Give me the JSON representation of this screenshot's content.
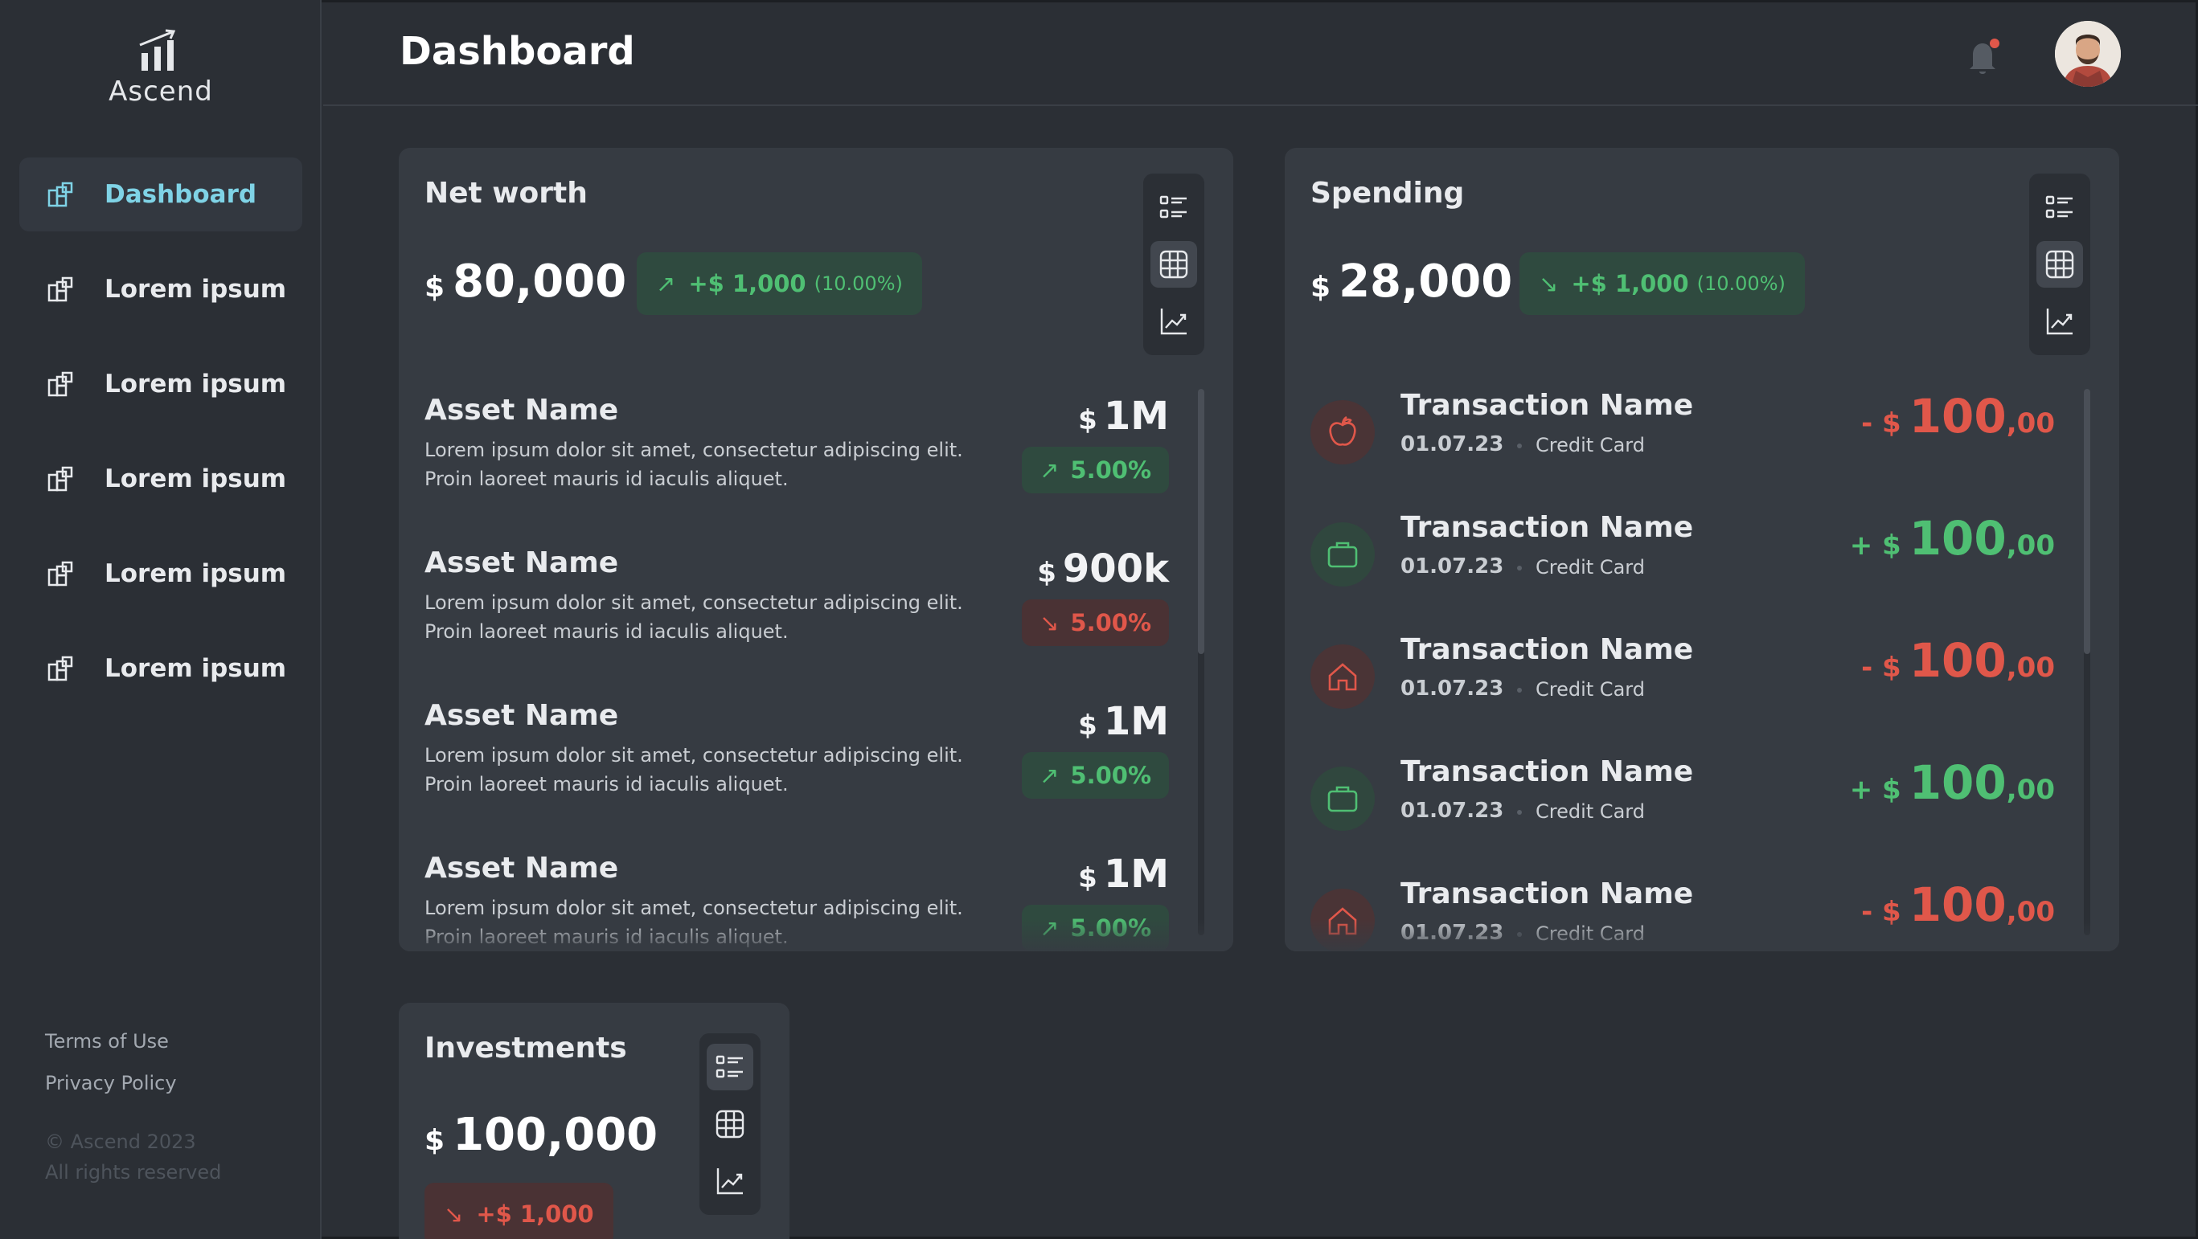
{
  "app": {
    "name": "Ascend"
  },
  "header": {
    "title": "Dashboard"
  },
  "sidebar": {
    "items": [
      {
        "label": "Dashboard",
        "active": true
      },
      {
        "label": "Lorem ipsum"
      },
      {
        "label": "Lorem ipsum"
      },
      {
        "label": "Lorem ipsum"
      },
      {
        "label": "Lorem ipsum"
      },
      {
        "label": "Lorem ipsum"
      }
    ],
    "footer": {
      "terms": "Terms of Use",
      "privacy": "Privacy Policy",
      "copyright": "© Ascend 2023",
      "rights": "All rights reserved"
    }
  },
  "net_worth": {
    "title": "Net worth",
    "currency": "$",
    "amount": "80,000",
    "change": "+$ 1,000",
    "change_pct": "(10.00%)",
    "assets": [
      {
        "name": "Asset Name",
        "desc": "Lorem ipsum dolor sit amet, consectetur adipiscing elit. Proin laoreet mauris id iaculis aliquet.",
        "currency": "$",
        "value": "1M",
        "change": "5.00%",
        "trend": "up"
      },
      {
        "name": "Asset Name",
        "desc": "Lorem ipsum dolor sit amet, consectetur adipiscing elit. Proin laoreet mauris id iaculis aliquet.",
        "currency": "$",
        "value": "900k",
        "change": "5.00%",
        "trend": "down"
      },
      {
        "name": "Asset Name",
        "desc": "Lorem ipsum dolor sit amet, consectetur adipiscing elit. Proin laoreet mauris id iaculis aliquet.",
        "currency": "$",
        "value": "1M",
        "change": "5.00%",
        "trend": "up"
      },
      {
        "name": "Asset Name",
        "desc": "Lorem ipsum dolor sit amet, consectetur adipiscing elit. Proin laoreet mauris id iaculis aliquet.",
        "currency": "$",
        "value": "1M",
        "change": "5.00%",
        "trend": "up"
      }
    ]
  },
  "spending": {
    "title": "Spending",
    "currency": "$",
    "amount": "28,000",
    "change": "+$ 1,000",
    "change_pct": "(10.00%)",
    "transactions": [
      {
        "name": "Transaction Name",
        "date": "01.07.23",
        "method": "Credit Card",
        "sign": "- $",
        "amount": "100",
        "cents": ",00",
        "icon": "apple-icon",
        "tone": "red"
      },
      {
        "name": "Transaction Name",
        "date": "01.07.23",
        "method": "Credit Card",
        "sign": "+ $",
        "amount": "100",
        "cents": ",00",
        "icon": "briefcase-icon",
        "tone": "green"
      },
      {
        "name": "Transaction Name",
        "date": "01.07.23",
        "method": "Credit Card",
        "sign": "- $",
        "amount": "100",
        "cents": ",00",
        "icon": "home-icon",
        "tone": "red"
      },
      {
        "name": "Transaction Name",
        "date": "01.07.23",
        "method": "Credit Card",
        "sign": "+ $",
        "amount": "100",
        "cents": ",00",
        "icon": "briefcase-icon",
        "tone": "green"
      },
      {
        "name": "Transaction Name",
        "date": "01.07.23",
        "method": "Credit Card",
        "sign": "- $",
        "amount": "100",
        "cents": ",00",
        "icon": "home-icon",
        "tone": "red"
      }
    ]
  },
  "investments": {
    "title": "Investments",
    "currency": "$",
    "amount": "100,000",
    "change": "+$ 1,000"
  },
  "colors": {
    "accent": "#7fd3e6",
    "positive": "#4fbf73",
    "negative": "#e0574a",
    "background": "#2b2f35",
    "card": "#363b42"
  }
}
